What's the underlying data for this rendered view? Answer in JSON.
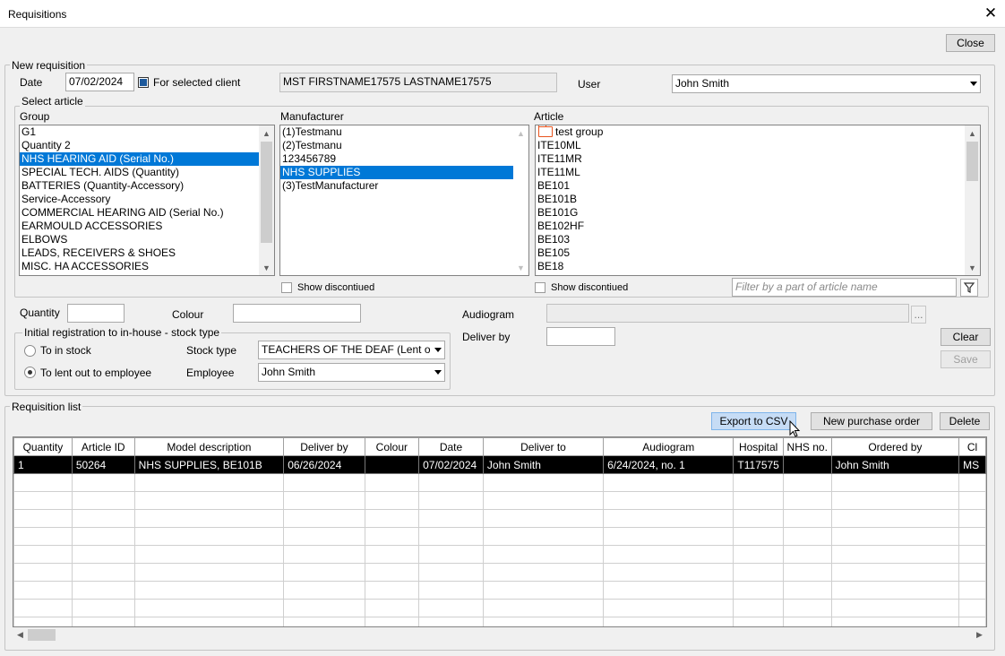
{
  "window": {
    "title": "Requisitions",
    "close_glyph": "✕"
  },
  "toolbar": {
    "close_label": "Close"
  },
  "new_requisition": {
    "legend": "New requisition",
    "date_label": "Date",
    "date_value": "07/02/2024",
    "for_selected_client_label": "For selected client",
    "for_selected_client_checked": true,
    "client_name": "MST FIRSTNAME17575 LASTNAME17575",
    "user_label": "User",
    "user_value": "John Smith"
  },
  "select_article": {
    "legend": "Select article",
    "group_label": "Group",
    "groups": [
      "G1",
      "Quantity 2",
      "NHS HEARING AID (Serial No.)",
      "SPECIAL TECH. AIDS (Quantity)",
      "BATTERIES (Quantity-Accessory)",
      "Service-Accessory",
      "COMMERCIAL HEARING AID (Serial No.)",
      "EARMOULD ACCESSORIES",
      "ELBOWS",
      "LEADS, RECEIVERS & SHOES",
      "MISC. HA  ACCESSORIES"
    ],
    "group_selected_index": 2,
    "manufacturer_label": "Manufacturer",
    "manufacturers": [
      "(1)Testmanu",
      "(2)Testmanu",
      "123456789",
      "NHS SUPPLIES",
      "(3)TestManufacturer"
    ],
    "manufacturer_selected_index": 3,
    "article_label": "Article",
    "article_folder": "test group",
    "articles": [
      "ITE10ML",
      "ITE11MR",
      "ITE11ML",
      "BE101",
      "BE101B",
      "BE101G",
      "BE102HF",
      "BE103",
      "BE105",
      "BE18"
    ],
    "show_discontinued_label": "Show discontiued",
    "filter_placeholder": "Filter by a part of article name"
  },
  "details": {
    "quantity_label": "Quantity",
    "colour_label": "Colour",
    "audiogram_label": "Audiogram",
    "audiogram_browse": "...",
    "deliver_by_label": "Deliver by",
    "clear_label": "Clear",
    "save_label": "Save"
  },
  "initial_registration": {
    "legend": "Initial registration to in-house - stock type",
    "to_in_stock_label": "To in stock",
    "to_lent_label": "To lent out to employee",
    "selected": "to_lent",
    "stock_type_label": "Stock type",
    "stock_type_value": "TEACHERS OF THE DEAF (Lent o",
    "employee_label": "Employee",
    "employee_value": "John Smith"
  },
  "requisition_list": {
    "legend": "Requisition list",
    "export_csv_label": "Export to CSV",
    "new_po_label": "New purchase order",
    "delete_label": "Delete",
    "columns": [
      "Quantity",
      "Article ID",
      "Model description",
      "Deliver by",
      "Colour",
      "Date",
      "Deliver to",
      "Audiogram",
      "Hospital",
      "NHS no.",
      "Ordered by",
      "Cl"
    ],
    "rows": [
      [
        "1",
        "50264",
        "NHS SUPPLIES, BE101B",
        "06/26/2024",
        "",
        "07/02/2024",
        "John Smith",
        "6/24/2024, no. 1",
        "T117575",
        "",
        "John Smith",
        "MS"
      ]
    ],
    "empty_rows": 9
  },
  "icons": {
    "scroll_up": "▲",
    "scroll_down": "▼",
    "scroll_left": "◀",
    "scroll_right": "▶",
    "folder": "folder-icon",
    "filter": "funnel-icon",
    "cursor": "mouse-pointer-icon"
  },
  "colors": {
    "selection": "#0078d7",
    "checkbox_fill": "#1e5a9c",
    "folder": "#e8541e",
    "button_hover": "#c6dcf5"
  }
}
